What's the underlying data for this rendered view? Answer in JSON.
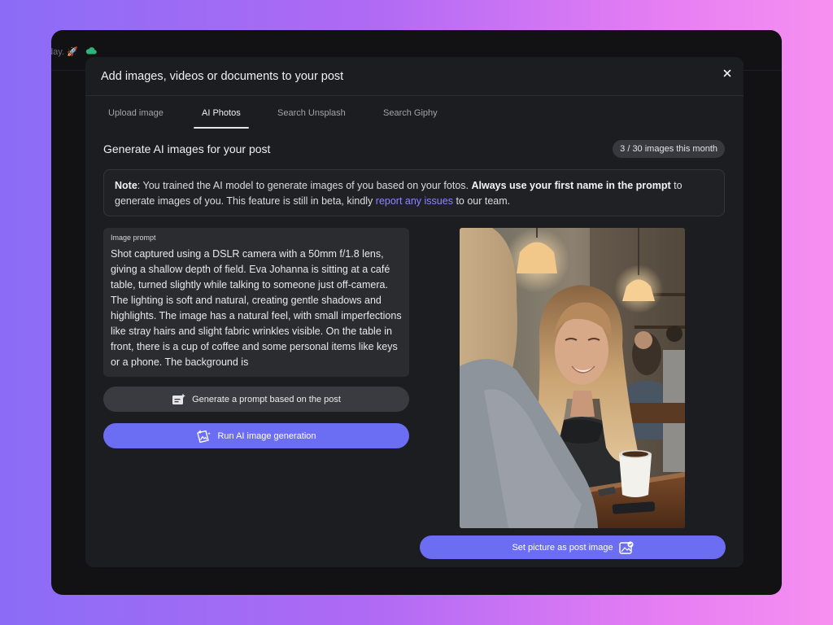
{
  "background_app": {
    "topbar_text": "day. 🚀"
  },
  "modal": {
    "title": "Add images, videos or documents to your post",
    "close_glyph": "×"
  },
  "tabs": [
    {
      "label": "Upload image"
    },
    {
      "label": "AI Photos",
      "active": true
    },
    {
      "label": "Search Unsplash"
    },
    {
      "label": "Search Giphy"
    }
  ],
  "section": {
    "title": "Generate AI images for your post",
    "quota": "3 / 30 images this month"
  },
  "note": {
    "label": "Note",
    "text_1": ": You trained the AI model to generate images of you based on your fotos. ",
    "bold_text": "Always use your first name in the prompt",
    "text_2": " to generate images of you. This feature is still in beta, kindly ",
    "link_text": "report any issues",
    "text_3": " to our team."
  },
  "prompt": {
    "label": "Image prompt",
    "value": "Shot captured using a DSLR camera with a 50mm f/1.8 lens, giving a shallow depth of field. Eva Johanna is sitting at a café table, turned slightly while talking to someone just off-camera. The lighting is soft and natural, creating gentle shadows and highlights. The image has a natural feel, with small imperfections like stray hairs and slight fabric wrinkles visible. On the table in front, there is a cup of coffee and some personal items like keys or a phone. The background is"
  },
  "buttons": {
    "generate_prompt": "Generate a prompt based on the post",
    "run_generation": "Run AI image generation",
    "set_picture": "Set picture as post image"
  },
  "icons": {
    "close": "close-icon",
    "cloud": "cloud-icon",
    "generate": "sparkle-document-icon",
    "run": "sparkle-image-icon",
    "set": "image-check-icon"
  },
  "colors": {
    "accent": "#6b6df2",
    "link": "#8b86ff",
    "modal_bg": "#1c1d20"
  }
}
